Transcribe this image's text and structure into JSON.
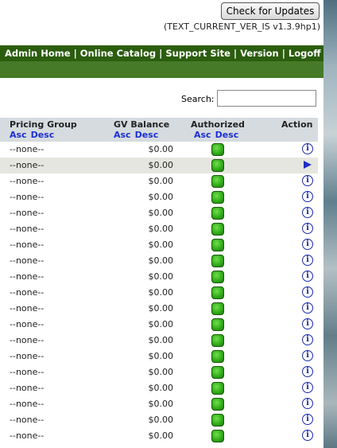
{
  "header": {
    "update_button": "Check for Updates",
    "version": "(TEXT_CURRENT_VER_IS v1.3.9hp1)"
  },
  "nav": {
    "items": [
      "Admin Home",
      "Online Catalog",
      "Support Site",
      "Version",
      "Logoff"
    ],
    "separator": "|"
  },
  "search": {
    "label": "Search:",
    "value": ""
  },
  "table": {
    "columns": {
      "pricing_group": "Pricing Group",
      "gv_balance": "GV Balance",
      "authorized": "Authorized",
      "action": "Action"
    },
    "sort": {
      "asc": "Asc",
      "desc": "Desc"
    },
    "rows": [
      {
        "group": "--none--",
        "gv": "$0.00",
        "authorized": true,
        "action": "info-icon"
      },
      {
        "group": "--none--",
        "gv": "$0.00",
        "authorized": true,
        "action": "arrow-icon",
        "selected": true
      },
      {
        "group": "--none--",
        "gv": "$0.00",
        "authorized": true,
        "action": "info-icon"
      },
      {
        "group": "--none--",
        "gv": "$0.00",
        "authorized": true,
        "action": "info-icon"
      },
      {
        "group": "--none--",
        "gv": "$0.00",
        "authorized": true,
        "action": "info-icon"
      },
      {
        "group": "--none--",
        "gv": "$0.00",
        "authorized": true,
        "action": "info-icon"
      },
      {
        "group": "--none--",
        "gv": "$0.00",
        "authorized": true,
        "action": "info-icon"
      },
      {
        "group": "--none--",
        "gv": "$0.00",
        "authorized": true,
        "action": "info-icon"
      },
      {
        "group": "--none--",
        "gv": "$0.00",
        "authorized": true,
        "action": "info-icon"
      },
      {
        "group": "--none--",
        "gv": "$0.00",
        "authorized": true,
        "action": "info-icon"
      },
      {
        "group": "--none--",
        "gv": "$0.00",
        "authorized": true,
        "action": "info-icon"
      },
      {
        "group": "--none--",
        "gv": "$0.00",
        "authorized": true,
        "action": "info-icon"
      },
      {
        "group": "--none--",
        "gv": "$0.00",
        "authorized": true,
        "action": "info-icon"
      },
      {
        "group": "--none--",
        "gv": "$0.00",
        "authorized": true,
        "action": "info-icon"
      },
      {
        "group": "--none--",
        "gv": "$0.00",
        "authorized": true,
        "action": "info-icon"
      },
      {
        "group": "--none--",
        "gv": "$0.00",
        "authorized": true,
        "action": "info-icon"
      },
      {
        "group": "--none--",
        "gv": "$0.00",
        "authorized": true,
        "action": "info-icon"
      },
      {
        "group": "--none--",
        "gv": "$0.00",
        "authorized": true,
        "action": "info-icon"
      },
      {
        "group": "--none--",
        "gv": "$0.00",
        "authorized": true,
        "action": "info-icon"
      }
    ]
  },
  "colors": {
    "nav_bg": "#2b5d0f",
    "nav_sub_bg": "#467a28",
    "sort_link": "#1b2fd8",
    "authorized_green": "#2fa818",
    "row_alt": "#e6e6e0"
  }
}
